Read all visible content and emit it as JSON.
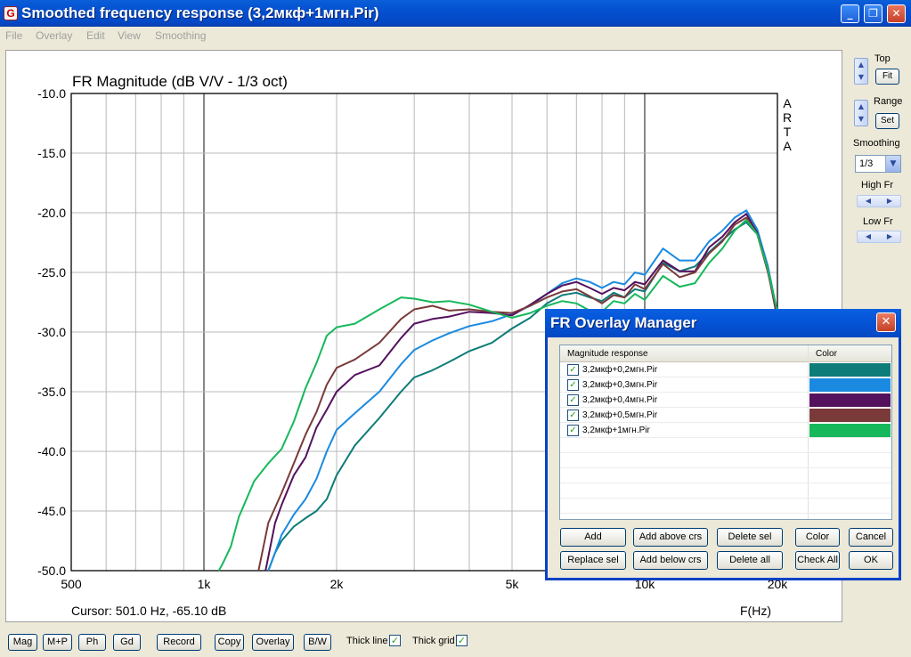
{
  "window": {
    "title": "Smoothed frequency response (3,2мкф+1мгн.Pir)",
    "controls": [
      "_",
      "❐",
      "✕"
    ]
  },
  "menu": [
    "File",
    "Overlay",
    "Edit",
    "View",
    "Smoothing"
  ],
  "right_panel": {
    "top_label": "Top",
    "fit_button": "Fit",
    "range_label": "Range",
    "set_button": "Set",
    "smoothing_label": "Smoothing",
    "smoothing_value": "1/3",
    "high_fr_label": "High Fr",
    "low_fr_label": "Low Fr"
  },
  "bottom_bar": {
    "buttons": [
      "Mag",
      "M+P",
      "Ph",
      "Gd",
      "Record",
      "Copy",
      "Overlay",
      "B/W"
    ],
    "thick_line_label": "Thick line",
    "thick_grid_label": "Thick grid"
  },
  "chart_data": {
    "type": "line",
    "title": "FR Magnitude (dB V/V - 1/3 oct)",
    "watermark": [
      "A",
      "R",
      "T",
      "A"
    ],
    "xlabel": "F(Hz)",
    "x_scale": "log",
    "xlim": [
      500,
      20000
    ],
    "ylim": [
      -50,
      -10
    ],
    "x_tick_labels": [
      {
        "value": 500,
        "label": "500"
      },
      {
        "value": 1000,
        "label": "1k"
      },
      {
        "value": 2000,
        "label": "2k"
      },
      {
        "value": 5000,
        "label": "5k"
      },
      {
        "value": 10000,
        "label": "10k"
      },
      {
        "value": 20000,
        "label": "20k"
      }
    ],
    "y_ticks": [
      -10,
      -15,
      -20,
      -25,
      -30,
      -35,
      -40,
      -45,
      -50
    ],
    "y_tick_labels": [
      "-10.0",
      "-15.0",
      "-20.0",
      "-25.0",
      "-30.0",
      "-35.0",
      "-40.0",
      "-45.0",
      "-50.0"
    ],
    "cursor_text": "Cursor: 501.0 Hz, -65.10 dB",
    "grid": true,
    "series": [
      {
        "name": "3,2мкф+0,2мгн.Pir",
        "color": "#0e7c78",
        "x": [
          1400,
          1450,
          1500,
          1600,
          1700,
          1800,
          1900,
          2000,
          2200,
          2500,
          2800,
          3000,
          3300,
          3600,
          4000,
          4500,
          5000,
          5500,
          6000,
          6500,
          7000,
          7500,
          8000,
          8500,
          9000,
          9500,
          10000,
          11000,
          12000,
          13000,
          14000,
          15000,
          16000,
          17000,
          18000,
          19000,
          20000
        ],
        "y": [
          -50,
          -48.5,
          -47.5,
          -46.3,
          -45.6,
          -45,
          -44,
          -42,
          -39.5,
          -37.2,
          -35,
          -33.8,
          -33.2,
          -32.5,
          -31.6,
          -30.9,
          -29.7,
          -28.8,
          -27.6,
          -26.9,
          -26.7,
          -27.1,
          -27.4,
          -26.7,
          -27.1,
          -26.4,
          -26.6,
          -24.2,
          -24.9,
          -24.5,
          -23.3,
          -22.3,
          -21.4,
          -20.8,
          -21.8,
          -24.4,
          -28.4
        ]
      },
      {
        "name": "3,2мкф+0,3мгн.Pir",
        "color": "#1a8ae0",
        "x": [
          1400,
          1450,
          1500,
          1600,
          1700,
          1800,
          1900,
          2000,
          2200,
          2500,
          2800,
          3000,
          3300,
          3600,
          4000,
          4500,
          5000,
          5500,
          6000,
          6500,
          7000,
          7500,
          8000,
          8500,
          9000,
          9500,
          10000,
          11000,
          12000,
          13000,
          14000,
          15000,
          16000,
          17000,
          18000,
          19000,
          20000
        ],
        "y": [
          -50,
          -48.5,
          -47,
          -45.3,
          -44,
          -42.3,
          -40,
          -38.2,
          -36.8,
          -35,
          -32.7,
          -31.5,
          -30.7,
          -30.1,
          -29.5,
          -29.1,
          -28.5,
          -27.8,
          -26.8,
          -25.9,
          -25.5,
          -25.8,
          -26.3,
          -25.8,
          -26.0,
          -25.0,
          -25.2,
          -23.0,
          -24.0,
          -24.0,
          -22.4,
          -21.5,
          -20.4,
          -19.8,
          -21.4,
          -24.4,
          -28.6
        ]
      },
      {
        "name": "3,2мкф+0,4мгн.Pir",
        "color": "#54115e",
        "x": [
          1380,
          1450,
          1500,
          1600,
          1700,
          1800,
          1900,
          2000,
          2200,
          2500,
          2800,
          3000,
          3300,
          3600,
          4000,
          4500,
          5000,
          5500,
          6000,
          6500,
          7000,
          7500,
          8000,
          8500,
          9000,
          9500,
          10000,
          11000,
          12000,
          13000,
          14000,
          15000,
          16000,
          17000,
          18000,
          19000,
          20000
        ],
        "y": [
          -50,
          -46,
          -44.5,
          -42,
          -40.5,
          -38,
          -36.5,
          -35,
          -33.6,
          -32.8,
          -30.5,
          -29.3,
          -28.9,
          -28.7,
          -28.3,
          -28.4,
          -28.6,
          -27.7,
          -26.8,
          -26.1,
          -25.8,
          -26.3,
          -26.8,
          -26.3,
          -26.5,
          -25.8,
          -26.0,
          -24.0,
          -24.9,
          -24.9,
          -22.9,
          -22.0,
          -20.8,
          -20.1,
          -21.7,
          -24.7,
          -28.9
        ]
      },
      {
        "name": "3,2мкф+0,5мгн.Pir",
        "color": "#7a3a3a",
        "x": [
          1330,
          1400,
          1500,
          1600,
          1700,
          1800,
          1900,
          2000,
          2200,
          2500,
          2800,
          3000,
          3300,
          3600,
          4000,
          4500,
          5000,
          5500,
          6000,
          6500,
          7000,
          7500,
          8000,
          8500,
          9000,
          9500,
          10000,
          11000,
          12000,
          13000,
          14000,
          15000,
          16000,
          17000,
          18000,
          19000,
          20000
        ],
        "y": [
          -50,
          -46,
          -43.5,
          -41,
          -38.6,
          -36.7,
          -34.4,
          -33,
          -32.3,
          -30.9,
          -28.9,
          -28.1,
          -27.8,
          -28.2,
          -28.1,
          -28.3,
          -28.4,
          -27.8,
          -27.1,
          -26.6,
          -26.4,
          -27.0,
          -27.6,
          -26.9,
          -27.1,
          -26.0,
          -26.4,
          -24.3,
          -25.4,
          -25.0,
          -23.4,
          -22.4,
          -21.0,
          -20.4,
          -21.8,
          -24.9,
          -28.6
        ]
      },
      {
        "name": "3,2мкф+1мгн.Pir",
        "color": "#17b85c",
        "x": [
          1080,
          1100,
          1150,
          1200,
          1300,
          1400,
          1500,
          1600,
          1700,
          1800,
          1900,
          2000,
          2200,
          2500,
          2800,
          3000,
          3300,
          3600,
          4000,
          4500,
          5000,
          5500,
          6000,
          6500,
          7000,
          7500,
          8000,
          8500,
          9000,
          9500,
          10000,
          11000,
          12000,
          13000,
          14000,
          15000,
          16000,
          17000,
          18000,
          19000,
          20000
        ],
        "y": [
          -50,
          -49.5,
          -48,
          -45.5,
          -42.5,
          -41,
          -39.8,
          -37.5,
          -34.7,
          -32.6,
          -30.3,
          -29.6,
          -29.3,
          -28.1,
          -27.1,
          -27.2,
          -27.5,
          -27.4,
          -27.7,
          -28.3,
          -28.8,
          -28.4,
          -27.8,
          -27.4,
          -27.6,
          -28.2,
          -28.3,
          -27.4,
          -27.6,
          -26.8,
          -27.3,
          -25.3,
          -26.2,
          -25.9,
          -24.2,
          -23.0,
          -21.5,
          -20.6,
          -21.8,
          -24.7,
          -28.3
        ]
      }
    ]
  },
  "overlay_dialog": {
    "title": "FR Overlay Manager",
    "col_response": "Magnitude response",
    "col_color": "Color",
    "rows": [
      {
        "label": "3,2мкф+0,2мгн.Pir",
        "color": "#0e7c78"
      },
      {
        "label": "3,2мкф+0,3мгн.Pir",
        "color": "#1a8ae0"
      },
      {
        "label": "3,2мкф+0,4мгн.Pir",
        "color": "#54115e"
      },
      {
        "label": "3,2мкф+0,5мгн.Pir",
        "color": "#7a3a3a"
      },
      {
        "label": "3,2мкф+1мгн.Pir",
        "color": "#17b85c"
      }
    ],
    "buttons_row1": [
      "Add",
      "Add above crs",
      "Delete sel",
      "Color",
      "Cancel"
    ],
    "buttons_row2": [
      "Replace sel",
      "Add below crs",
      "Delete all",
      "Check All",
      "OK"
    ]
  }
}
